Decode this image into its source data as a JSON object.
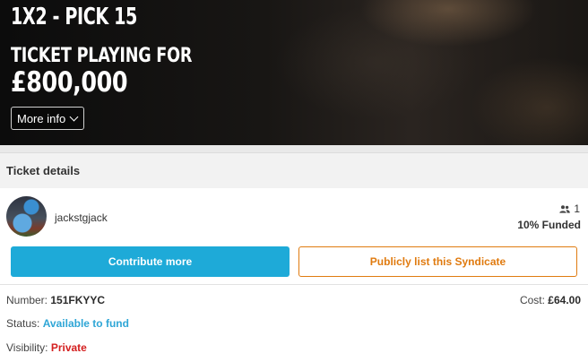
{
  "hero": {
    "title": "1X2 - PICK 15",
    "subtitle": "TICKET PLAYING FOR",
    "amount": "£800,000",
    "more_info_label": "More info"
  },
  "details": {
    "header": "Ticket details",
    "username": "jackstgjack",
    "members_count": "1",
    "funded_text": "10% Funded",
    "funded_percent": 10
  },
  "actions": {
    "contribute_label": "Contribute more",
    "list_label": "Publicly list this Syndicate"
  },
  "info": {
    "number_label": "Number:",
    "number_value": "151FKYYC",
    "cost_label": "Cost:",
    "cost_value": "£64.00",
    "status_label": "Status:",
    "status_value": "Available to fund",
    "visibility_label": "Visibility:",
    "visibility_value": "Private"
  },
  "colors": {
    "contribute_bg": "#1eaad8",
    "list_border": "#e07b10",
    "status_value": "#2fa6d6",
    "visibility_value": "#d42020"
  },
  "icons": {
    "members": "people-icon",
    "more_info": "chevron-down-icon"
  }
}
